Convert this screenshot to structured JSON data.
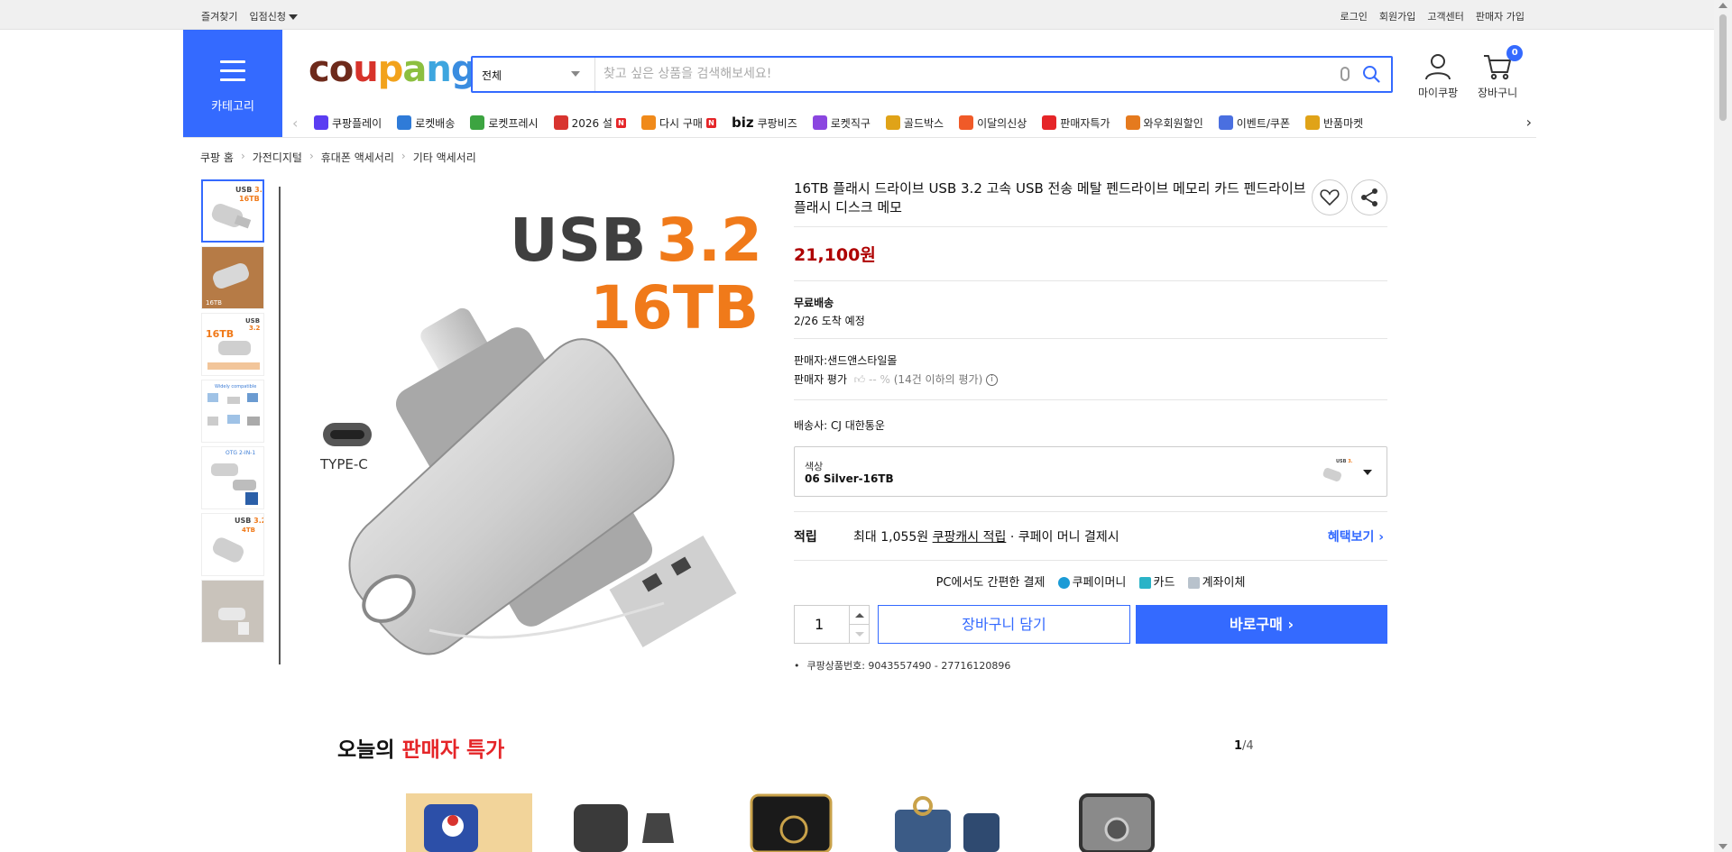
{
  "topbar": {
    "left": [
      "즐겨찾기",
      "입점신청"
    ],
    "right": [
      "로그인",
      "회원가입",
      "고객센터",
      "판매자 가입"
    ]
  },
  "header": {
    "category_label": "카테고리",
    "logo_text": "coupang",
    "search_category": "전체",
    "search_placeholder": "찾고 싶은 상품을 검색해보세요!",
    "mypage_label": "마이쿠팡",
    "cart_label": "장바구니",
    "cart_count": "0",
    "colors": {
      "brand_blue": "#346aff",
      "price_red": "#ae0000"
    }
  },
  "menu": [
    {
      "label": "쿠팡플레이",
      "color": "#5b3df2",
      "new": false
    },
    {
      "label": "로켓배송",
      "color": "#2f7bd8",
      "new": false
    },
    {
      "label": "로켓프레시",
      "color": "#3ca441",
      "new": false
    },
    {
      "label": "2026 설",
      "color": "#d8342f",
      "new": true
    },
    {
      "label": "다시 구매",
      "color": "#f08a1a",
      "new": true
    },
    {
      "label": "쿠팡비즈",
      "prefix": "biz",
      "color": "#111",
      "new": false
    },
    {
      "label": "로켓직구",
      "color": "#8b46e0",
      "new": false
    },
    {
      "label": "골드박스",
      "color": "#e0a318",
      "new": false
    },
    {
      "label": "이달의신상",
      "color": "#f05a28",
      "new": false
    },
    {
      "label": "판매자특가",
      "color": "#e52528",
      "new": false
    },
    {
      "label": "와우회원할인",
      "color": "#e57a1e",
      "new": false
    },
    {
      "label": "이벤트/쿠폰",
      "color": "#4a6fe0",
      "new": false
    },
    {
      "label": "반품마켓",
      "color": "#e0a318",
      "new": false
    }
  ],
  "breadcrumb": [
    "쿠팡 홈",
    "가전디지털",
    "휴대폰 액세서리",
    "기타 액세서리"
  ],
  "product": {
    "title": "16TB 플래시 드라이브 USB 3.2 고속 USB 전송 메탈 펜드라이브 메모리 카드 펜드라이브 플래시 디스크 메모",
    "price": "21,100원",
    "shipping_title": "무료배송",
    "shipping_date": "2/26 도착 예정",
    "seller": "판매자:샌드앤스타일몰",
    "seller_rating_label": "판매자 평가",
    "seller_rating_value": "-- %",
    "seller_rating_note": "(14건 이하의 평가)",
    "carrier": "배송사: CJ 대한통운",
    "option_label": "색상",
    "option_value": "06 Silver-16TB",
    "reward_label": "적립",
    "reward_prefix": "최대 1,055원",
    "reward_link": "쿠팡캐시 적립",
    "reward_suffix": "· 쿠페이 머니 결제시",
    "reward_more": "혜택보기",
    "pay_title": "PC에서도 간편한 결제",
    "pay_methods": [
      "쿠페이머니",
      "카드",
      "계좌이체"
    ],
    "quantity": "1",
    "add_to_cart": "장바구니 담기",
    "buy_now": "바로구매",
    "product_number": "쿠팡상품번호: 9043557490 - 27716120896",
    "image_text": {
      "usb": "USB",
      "version": "3.2",
      "capacity": "16TB",
      "type": "TYPE-C"
    }
  },
  "deals": {
    "title_prefix": "오늘의",
    "title_highlight": "판매자 특가",
    "page_current": "1",
    "page_total": "/4"
  }
}
